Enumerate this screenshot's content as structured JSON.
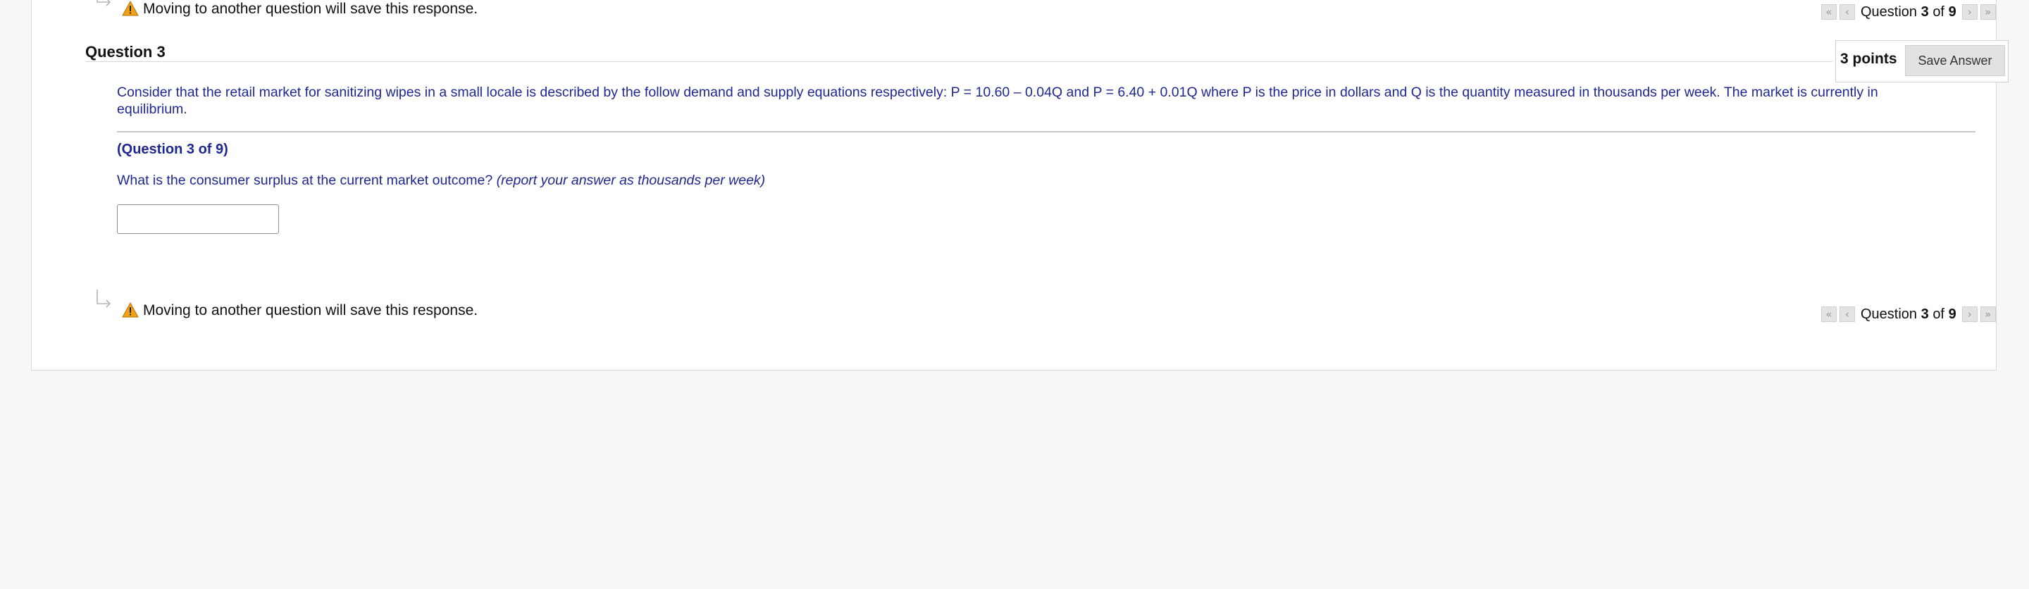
{
  "notice": {
    "text": "Moving to another question will save this response."
  },
  "question_nav": {
    "prefix": "Question",
    "current": "3",
    "of_word": "of",
    "total": "9",
    "first_glyph": "«",
    "prev_glyph": "‹",
    "next_glyph": "›",
    "last_glyph": "»"
  },
  "question": {
    "title": "Question 3",
    "points": "3 points",
    "save_label": "Save Answer",
    "stem": "Consider that the retail market for sanitizing wipes in a small locale is described by the follow demand and supply equations respectively:  P = 10.60 – 0.04Q and P = 6.40 + 0.01Q where P is the price in dollars and Q is the quantity measured in thousands per week. The market is currently in equilibrium.",
    "sub_label": "(Question 3 of 9)",
    "prompt": "What is the consumer surplus at the current market outcome?",
    "prompt_hint": "(report your answer as thousands per week)",
    "answer_value": ""
  },
  "colors": {
    "question_text": "#1f2790",
    "background": "#f7f7f7",
    "warning": "#f0a21a"
  },
  "icons": [
    "return-arrow-icon",
    "warning-icon",
    "double-chevron-left-icon",
    "chevron-left-icon",
    "chevron-right-icon",
    "double-chevron-right-icon"
  ]
}
